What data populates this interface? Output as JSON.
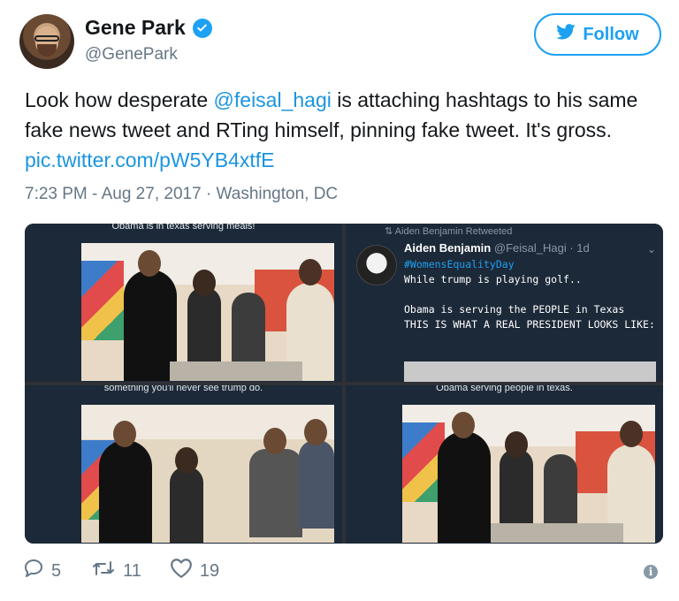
{
  "author": {
    "display_name": "Gene Park",
    "handle": "@GenePark",
    "verified_icon": "verified-badge-icon"
  },
  "follow_button": {
    "label": "Follow",
    "icon": "twitter-bird-icon",
    "color": "#1da1f2"
  },
  "tweet": {
    "text_before": "Look how desperate ",
    "mention": "@feisal_hagi",
    "text_after": " is attaching hashtags to his same fake news tweet and RTing himself, pinning fake tweet. It's gross. ",
    "link": "pic.twitter.com/pW5YB4xtfE",
    "timestamp": "7:23 PM - Aug 27, 2017 · Washington, DC"
  },
  "media": {
    "captions": [
      "Obama is in texas serving meals!",
      "something you'll never see trump do.",
      "Obama serving people in texas."
    ],
    "embedded_tweet": {
      "retweeted_by": "Aiden Benjamin Retweeted",
      "name": "Aiden Benjamin",
      "handle_time": "@Feisal_Hagi · 1d",
      "hashtag": "#WomensEqualityDay",
      "lines": [
        "While trump is playing golf..",
        "",
        "Obama is serving the PEOPLE in Texas",
        "THIS IS WHAT A REAL PRESIDENT LOOKS LIKE:"
      ]
    }
  },
  "actions": {
    "replies": "5",
    "retweets": "11",
    "likes": "19",
    "info": "i"
  },
  "colors": {
    "accent": "#1da1f2",
    "muted": "#657786",
    "link": "#1b95e0"
  }
}
